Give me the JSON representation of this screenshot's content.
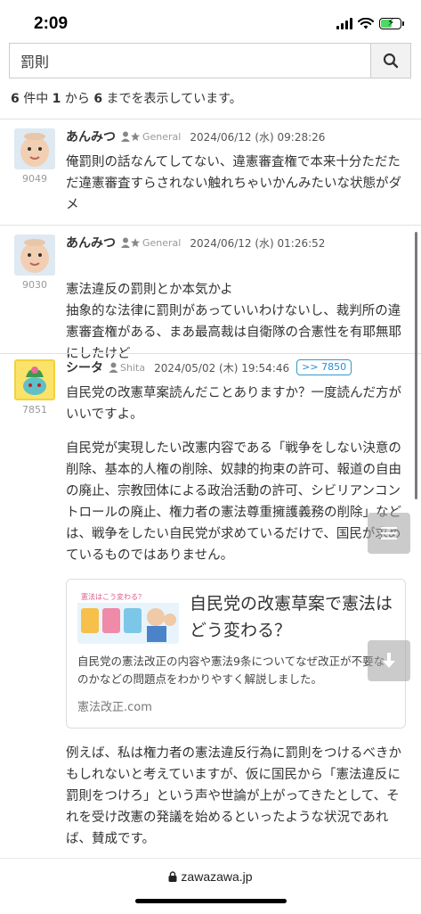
{
  "status": {
    "time": "2:09"
  },
  "search": {
    "value": "罰則",
    "button_icon": "search-icon"
  },
  "results": {
    "total": "6",
    "middle1": " 件中 ",
    "from": "1",
    "middle2": " から ",
    "to": "6",
    "suffix": " までを表示しています。"
  },
  "posts": [
    {
      "user_id": "9049",
      "author": "あんみつ",
      "rank": "General",
      "date": "2024/06/12 (水) 09:28:26",
      "paragraphs": [
        "俺罰則の話なんてしてない、違憲審査権で本来十分ただただ違憲審査すらされない触れちゃいかんみたいな状態がダメ"
      ]
    },
    {
      "user_id": "9030",
      "author": "あんみつ",
      "rank": "General",
      "date": "2024/06/12 (水) 01:26:52",
      "paragraphs": [
        "憲法違反の罰則とか本気かよ\n抽象的な法律に罰則があっていいわけないし、裁判所の違憲審査権がある、まあ最高裁は自衛隊の合憲性を有耶無耶にしたけど"
      ]
    },
    {
      "user_id": "7851",
      "author": "シータ",
      "handle": "Shita",
      "date": "2024/05/02 (木) 19:54:46",
      "reply": ">> 7850",
      "paragraphs": [
        "自民党の改憲草案読んだことありますか？一度読んだ方がいいですよ。",
        "自民党が実現したい改憲内容である「戦争をしない決意の削除、基本的人権の削除、奴隷的拘束の許可、報道の自由の廃止、宗教団体による政治活動の許可、シビリアンコントロールの廃止、権力者の憲法尊重擁護義務の削除」などは、戦争をしたい自民党が求めているだけで、国民が求めているものではありません。"
      ],
      "card": {
        "thumb_label": "憲法はこう変わる？",
        "title": "自民党の改憲草案で憲法はどう変わる？",
        "description": "自民党の憲法改正の内容や憲法9条についてなぜ改正が不要なのかなどの問題点をわかりやすく解説しました。",
        "domain": "憲法改正.com"
      },
      "after_paragraphs": [
        "例えば、私は権力者の憲法違反行為に罰則をつけるべきかもしれないと考えていますが、仮に国民から「憲法違反に罰則をつけろ」という声や世論が上がってきたとして、それを受け改憲の発議を始めるといったような状況であれば、賛成です。"
      ]
    }
  ],
  "floating": {
    "menu_icon": "menu-icon",
    "down_icon": "arrow-down-icon"
  },
  "browser": {
    "url": "zawazawa.jp"
  }
}
